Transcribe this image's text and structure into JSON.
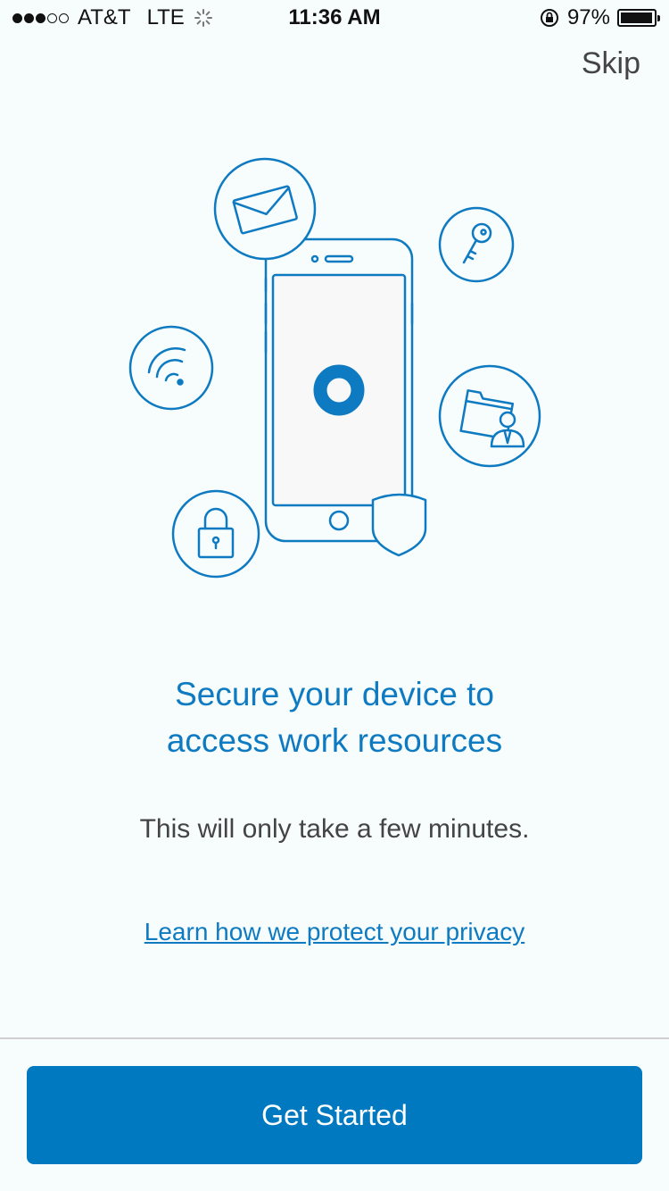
{
  "status_bar": {
    "signal_dots_filled": 3,
    "signal_dots_total": 5,
    "carrier": "AT&T",
    "network": "LTE",
    "time": "11:36 AM",
    "battery_percent": "97%",
    "battery_level": 0.97
  },
  "header": {
    "skip_label": "Skip"
  },
  "illustration": {
    "icons": [
      "mail-icon",
      "key-icon",
      "wifi-icon",
      "folder-user-icon",
      "lock-icon",
      "phone-icon",
      "shield-icon",
      "app-logo-icon"
    ],
    "stroke_color": "#0d7ac1"
  },
  "content": {
    "headline_line1": "Secure your device to",
    "headline_line2": "access work resources",
    "subtext": "This will only take a few minutes.",
    "privacy_link": "Learn how we protect your privacy"
  },
  "footer": {
    "button_label": "Get Started",
    "button_color": "#0079c1"
  }
}
